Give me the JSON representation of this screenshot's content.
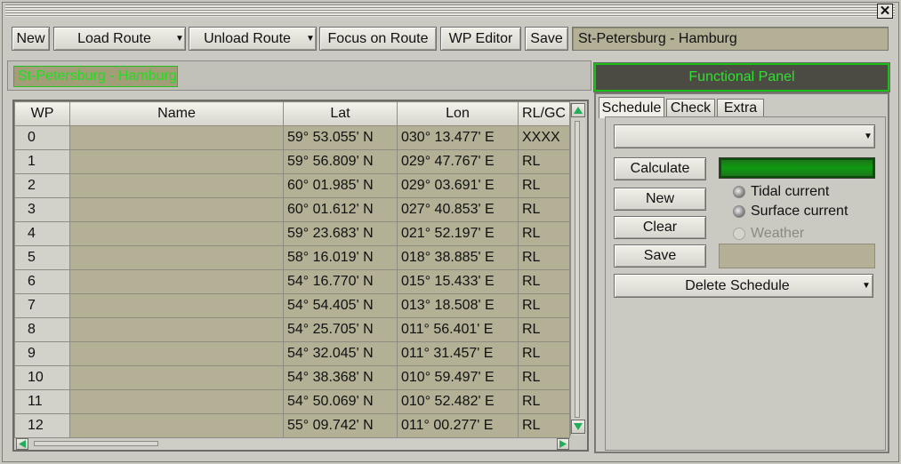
{
  "window": {
    "close_label": "✕"
  },
  "toolbar": {
    "new_label": "New",
    "load_route_label": "Load Route",
    "unload_route_label": "Unload Route",
    "focus_on_route_label": "Focus on Route",
    "wp_editor_label": "WP Editor",
    "save_label": "Save",
    "route_name": "St-Petersburg - Hamburg"
  },
  "route_header": {
    "name": "St-Petersburg - Hamburg",
    "functional_panel_label": "Functional Panel"
  },
  "grid": {
    "columns": [
      "WP",
      "Name",
      "Lat",
      "Lon",
      "RL/GC"
    ],
    "rows": [
      {
        "wp": "0",
        "name": "",
        "lat": "59° 53.055' N",
        "lon": "030° 13.477' E",
        "rlgc": "XXXX"
      },
      {
        "wp": "1",
        "name": "",
        "lat": "59° 56.809' N",
        "lon": "029° 47.767' E",
        "rlgc": "RL"
      },
      {
        "wp": "2",
        "name": "",
        "lat": "60° 01.985' N",
        "lon": "029° 03.691' E",
        "rlgc": "RL"
      },
      {
        "wp": "3",
        "name": "",
        "lat": "60° 01.612' N",
        "lon": "027° 40.853' E",
        "rlgc": "RL"
      },
      {
        "wp": "4",
        "name": "",
        "lat": "59° 23.683' N",
        "lon": "021° 52.197' E",
        "rlgc": "RL"
      },
      {
        "wp": "5",
        "name": "",
        "lat": "58° 16.019' N",
        "lon": "018° 38.885' E",
        "rlgc": "RL"
      },
      {
        "wp": "6",
        "name": "",
        "lat": "54° 16.770' N",
        "lon": "015° 15.433' E",
        "rlgc": "RL"
      },
      {
        "wp": "7",
        "name": "",
        "lat": "54° 54.405' N",
        "lon": "013° 18.508' E",
        "rlgc": "RL"
      },
      {
        "wp": "8",
        "name": "",
        "lat": "54° 25.705' N",
        "lon": "011° 56.401' E",
        "rlgc": "RL"
      },
      {
        "wp": "9",
        "name": "",
        "lat": "54° 32.045' N",
        "lon": "011° 31.457' E",
        "rlgc": "RL"
      },
      {
        "wp": "10",
        "name": "",
        "lat": "54° 38.368' N",
        "lon": "010° 59.497' E",
        "rlgc": "RL"
      },
      {
        "wp": "11",
        "name": "",
        "lat": "54° 50.069' N",
        "lon": "010° 52.482' E",
        "rlgc": "RL"
      },
      {
        "wp": "12",
        "name": "",
        "lat": "55° 09.742' N",
        "lon": "011° 00.277' E",
        "rlgc": "RL"
      }
    ]
  },
  "panel": {
    "tabs": [
      "Schedule",
      "Check",
      "Extra"
    ],
    "active_tab": "Schedule",
    "schedule_select_value": "",
    "calculate_label": "Calculate",
    "new_label": "New",
    "clear_label": "Clear",
    "save_label": "Save",
    "tidal_current_label": "Tidal current",
    "surface_current_label": "Surface current",
    "weather_label": "Weather",
    "delete_schedule_label": "Delete Schedule",
    "schedule_name_value": ""
  },
  "icons": {
    "dropdown": "chevron-down-icon",
    "scroll_up": "arrow-up-icon",
    "scroll_down": "arrow-down-icon",
    "scroll_left": "arrow-left-icon",
    "scroll_right": "arrow-right-icon",
    "close": "close-icon"
  },
  "colors": {
    "accent_green": "#22dd22",
    "cell_bg": "#b3b095",
    "panel_bg": "#cbcac2"
  }
}
